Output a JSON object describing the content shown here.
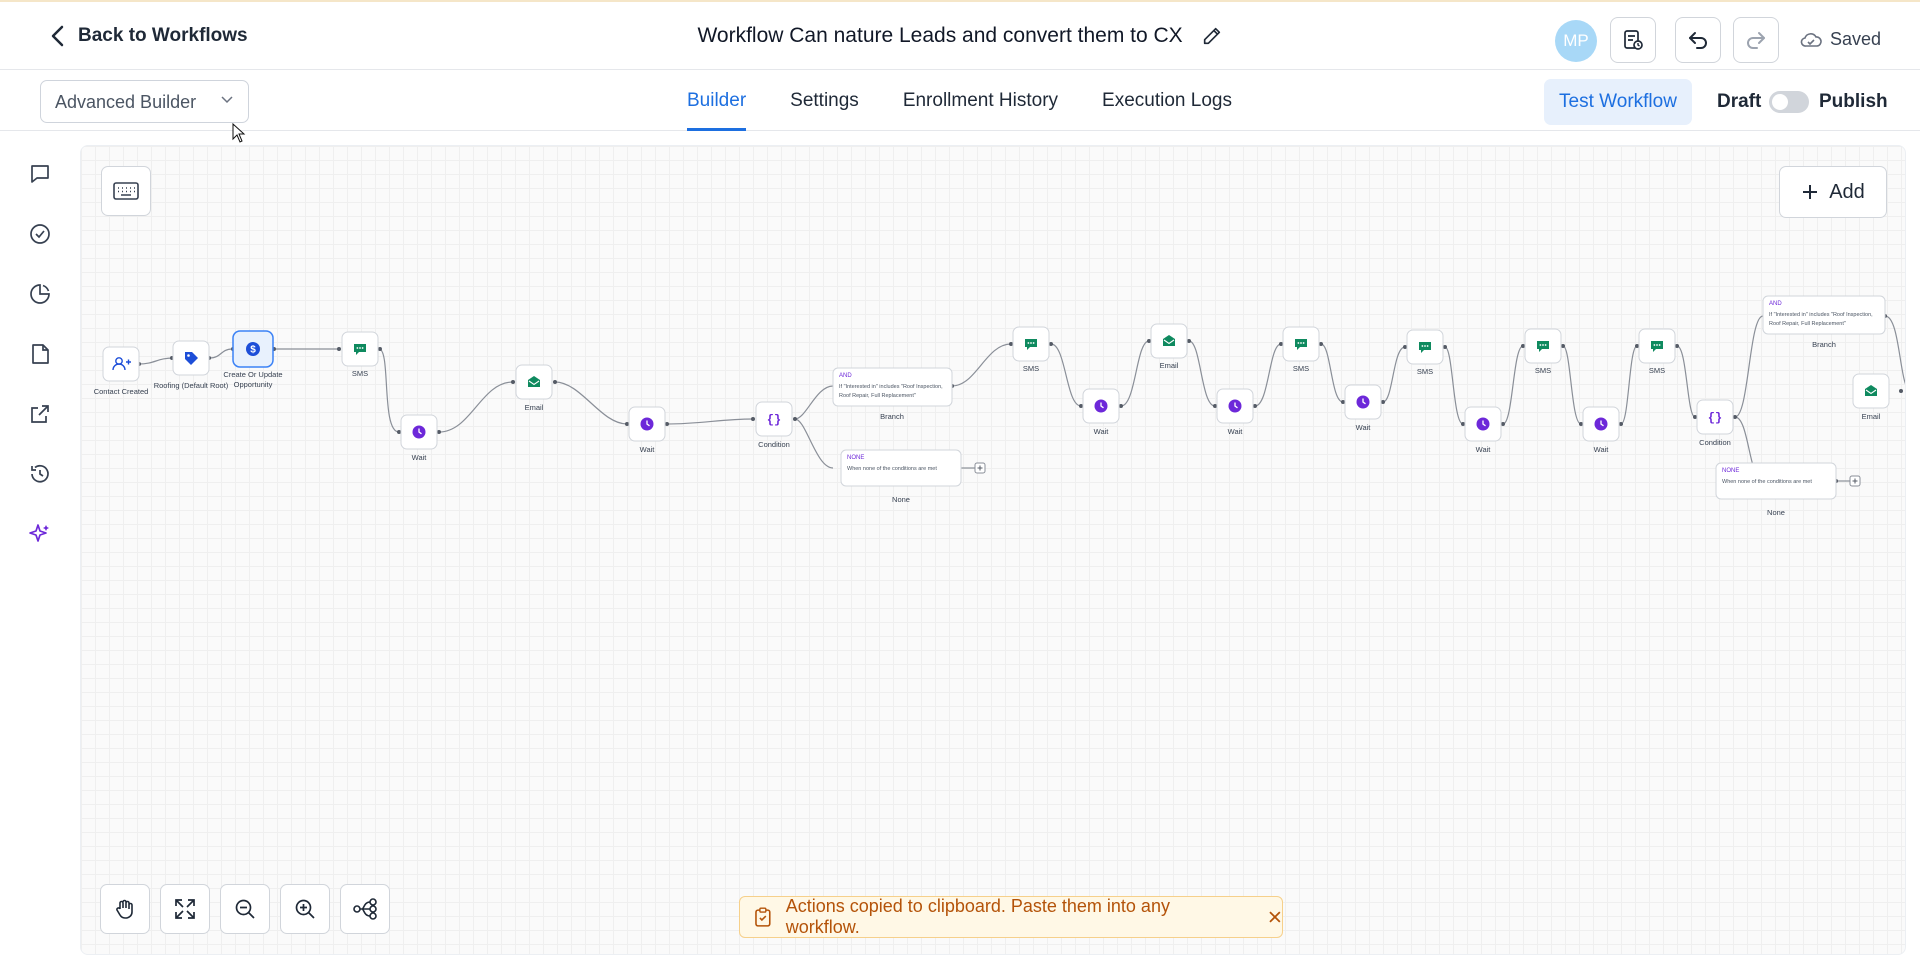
{
  "header": {
    "back_label": "Back to Workflows",
    "title": "Workflow Can nature Leads and convert them to CX",
    "avatar_initials": "MP",
    "saved_label": "Saved"
  },
  "subbar": {
    "builder_mode": "Advanced Builder",
    "tabs": [
      {
        "label": "Builder",
        "active": true
      },
      {
        "label": "Settings",
        "active": false
      },
      {
        "label": "Enrollment History",
        "active": false
      },
      {
        "label": "Execution Logs",
        "active": false
      }
    ],
    "test_label": "Test Workflow",
    "draft_label": "Draft",
    "publish_label": "Publish"
  },
  "canvas": {
    "add_label": "Add",
    "toast": "Actions copied to clipboard. Paste them into any workflow."
  },
  "flow": {
    "labels": {
      "contact_created": "Contact Created",
      "roofing": "Roofing (Default Root)",
      "create_opp_1": "Create Or Update",
      "create_opp_2": "Opportunity",
      "sms": "SMS",
      "wait": "Wait",
      "email": "Email",
      "condition": "Condition",
      "branch": "Branch",
      "none": "None",
      "and_tag": "AND",
      "none_tag": "NONE",
      "branch_text_1": "If \"Interested in\" includes \"Roof Inspection,",
      "branch_text_2": "Roof Repair, Full Replacement\"",
      "none_text": "When none of the conditions are met"
    }
  },
  "colors": {
    "accent": "#1d6fe0",
    "sms_icon": "#0f8a5f",
    "wait_icon": "#6d28d9",
    "tag_icon": "#1d4ed8",
    "toast_text": "#b45309"
  }
}
